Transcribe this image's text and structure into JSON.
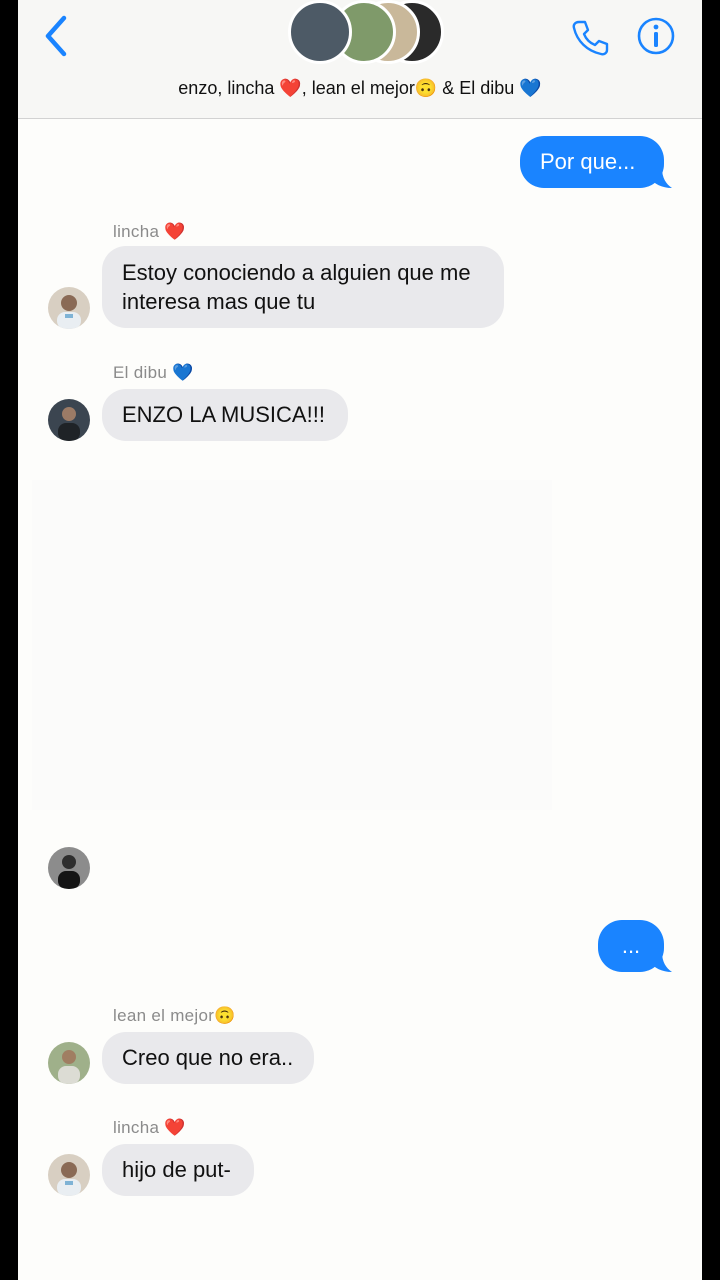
{
  "header": {
    "title": "enzo, lincha ❤️, lean el mejor🙃 & El dibu 💙",
    "back_icon": "chevron-left-icon",
    "call_icon": "phone-icon",
    "info_icon": "info-icon",
    "accent_color": "#1a84ff"
  },
  "messages": [
    {
      "type": "outgoing",
      "text": "Por que..."
    },
    {
      "type": "incoming",
      "sender": "lincha ❤️",
      "lines": [
        "Estoy conociendo a alguien que me",
        "interesa mas que tu"
      ]
    },
    {
      "type": "incoming",
      "sender": "El dibu 💙",
      "text": "ENZO LA MUSICA!!!"
    },
    {
      "type": "outgoing",
      "text": "..."
    },
    {
      "type": "incoming",
      "sender": "lean el mejor🙃",
      "text": "Creo que no era.."
    },
    {
      "type": "incoming",
      "sender": "lincha ❤️",
      "text": "hijo de put-"
    }
  ],
  "colors": {
    "outgoing_bubble": "#1a84ff",
    "incoming_bubble": "#e9e9ec",
    "sender_label": "#8b8b8b"
  }
}
